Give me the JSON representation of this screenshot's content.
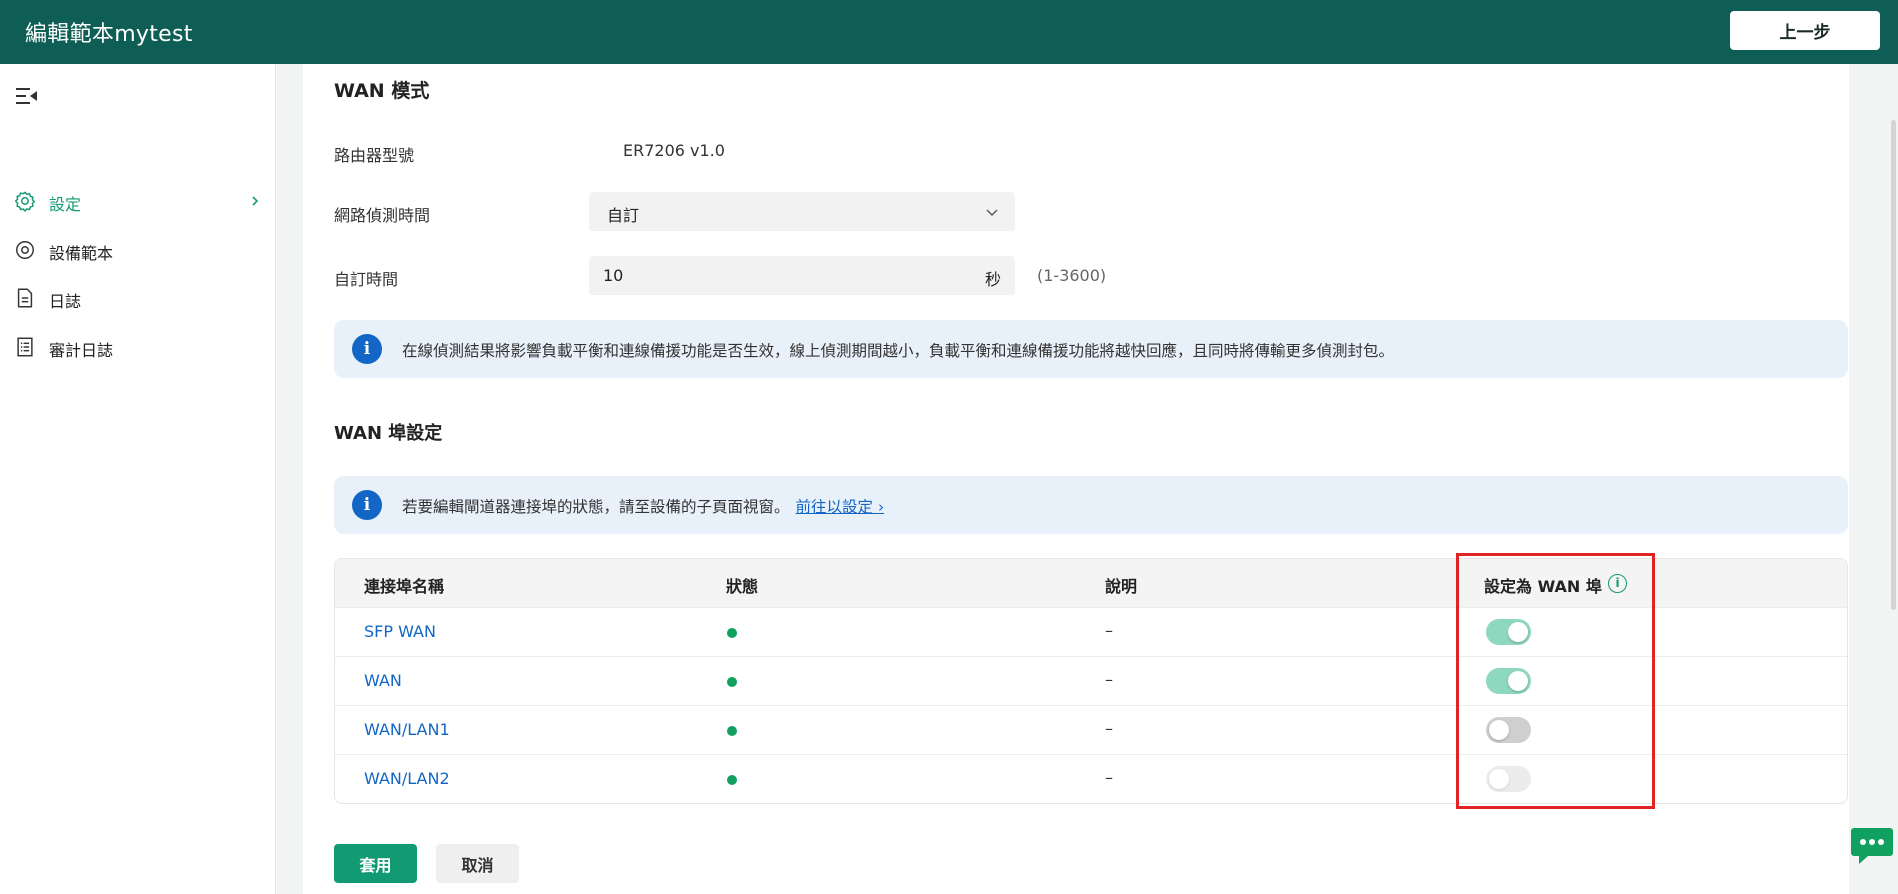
{
  "header": {
    "title": "編輯範本mytest",
    "back_label": "上一步"
  },
  "sidebar": {
    "items": [
      {
        "label": "設定",
        "icon": "gear-icon",
        "active": true
      },
      {
        "label": "設備範本",
        "icon": "target-icon",
        "active": false
      },
      {
        "label": "日誌",
        "icon": "document-icon",
        "active": false
      },
      {
        "label": "審計日誌",
        "icon": "list-icon",
        "active": false
      }
    ]
  },
  "wan_mode": {
    "title": "WAN 模式",
    "router_model_label": "路由器型號",
    "router_model_value": "ER7206 v1.0",
    "detect_time_label": "網路偵測時間",
    "detect_time_value": "自訂",
    "custom_time_label": "自訂時間",
    "custom_time_value": "10",
    "custom_time_unit": "秒",
    "custom_time_range": "(1-3600)",
    "info_text": "在線偵測結果將影響負載平衡和連線備援功能是否生效，線上偵測期間越小，負載平衡和連線備援功能將越快回應，且同時將傳輸更多偵測封包。"
  },
  "wan_port": {
    "title": "WAN 埠設定",
    "info_text": "若要編輯閘道器連接埠的狀態，請至設備的子頁面視窗。",
    "info_link": "前往以設定 ›",
    "columns": [
      "連接埠名稱",
      "狀態",
      "說明",
      "設定為 WAN 埠"
    ],
    "rows": [
      {
        "name": "SFP WAN",
        "status": "online",
        "desc": "–",
        "wan": "on"
      },
      {
        "name": "WAN",
        "status": "online",
        "desc": "–",
        "wan": "on"
      },
      {
        "name": "WAN/LAN1",
        "status": "online",
        "desc": "–",
        "wan": "off"
      },
      {
        "name": "WAN/LAN2",
        "status": "online",
        "desc": "–",
        "wan": "disabled"
      }
    ]
  },
  "actions": {
    "apply_label": "套用",
    "cancel_label": "取消"
  },
  "colors": {
    "header_bg": "#0e5e55",
    "accent": "#129a72",
    "link": "#1366c6",
    "info_bg": "#e8f0fa",
    "highlight": "#e02424"
  }
}
